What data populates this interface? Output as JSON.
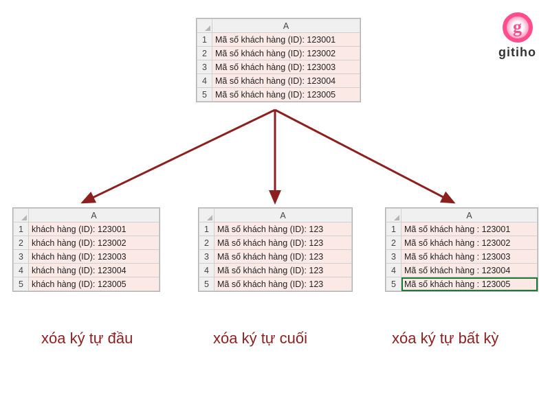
{
  "brand": {
    "glyph": "g",
    "name": "gitiho"
  },
  "column_label": "A",
  "tables": {
    "source": {
      "rows": [
        "Mã số khách hàng (ID): 123001",
        "Mã số khách hàng (ID): 123002",
        "Mã số khách hàng (ID): 123003",
        "Mã số khách hàng (ID): 123004",
        "Mã số khách hàng (ID): 123005"
      ]
    },
    "remove_first": {
      "caption": "xóa ký tự đầu",
      "rows": [
        "khách hàng (ID): 123001",
        "khách hàng (ID): 123002",
        "khách hàng (ID): 123003",
        "khách hàng (ID): 123004",
        "khách hàng (ID): 123005"
      ]
    },
    "remove_last": {
      "caption": "xóa ký tự cuối",
      "rows": [
        "Mã số khách hàng (ID): 123",
        "Mã số khách hàng (ID): 123",
        "Mã số khách hàng (ID): 123",
        "Mã số khách hàng (ID): 123",
        "Mã số khách hàng (ID): 123"
      ]
    },
    "remove_any": {
      "caption": "xóa ký tự bất kỳ",
      "rows": [
        "Mã số khách hàng : 123001",
        "Mã số khách hàng : 123002",
        "Mã số khách hàng : 123003",
        "Mã số khách hàng : 123004",
        "Mã số khách hàng : 123005"
      ]
    }
  },
  "colors": {
    "accent": "#8d1f1f",
    "cell_bg": "#fbe9e5",
    "brand": "#ff4d8d"
  }
}
